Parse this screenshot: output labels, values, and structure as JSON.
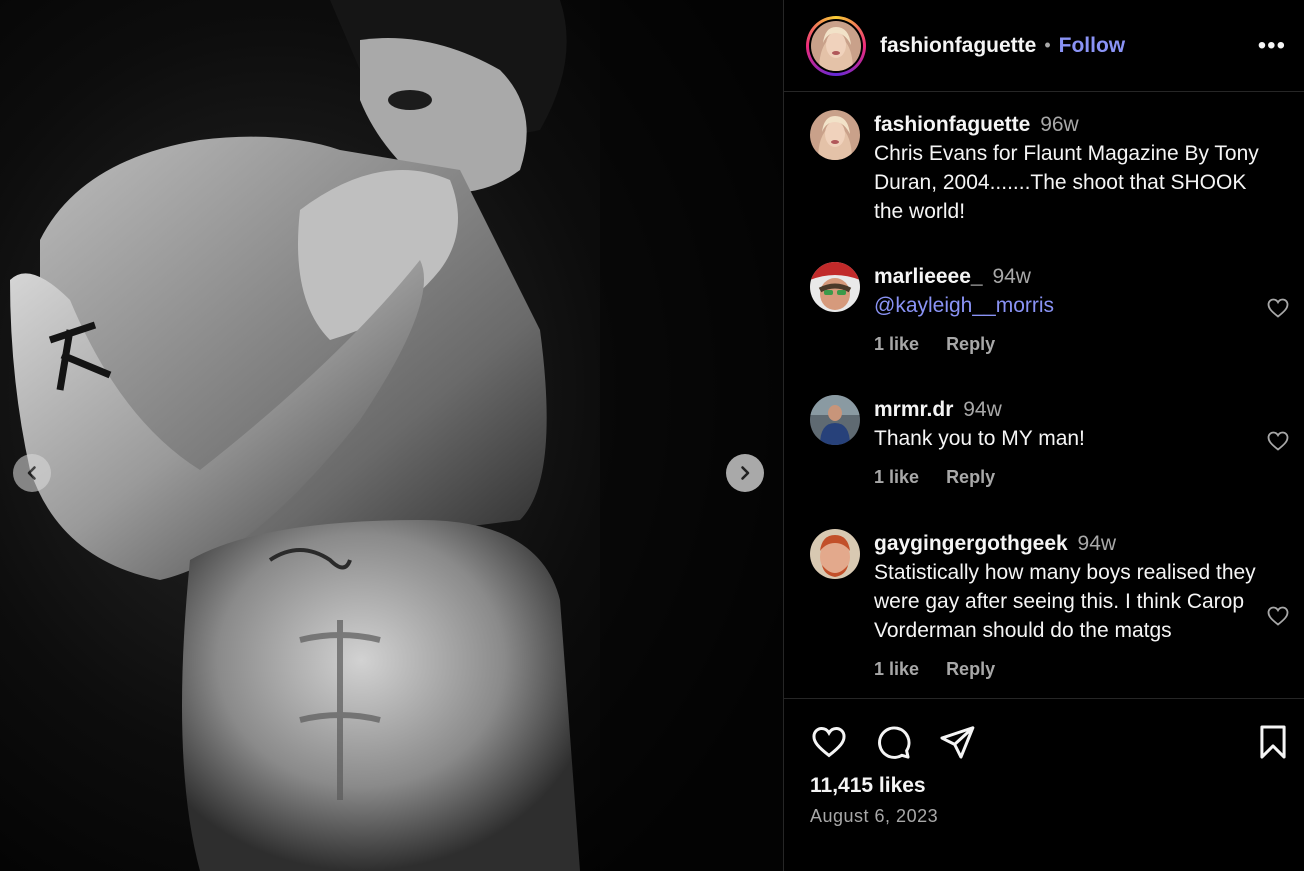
{
  "post": {
    "username": "fashionfaguette",
    "follow_label": "Follow",
    "separator": "•",
    "more_label": "•••",
    "likes": "11,415 likes",
    "date": "August 6, 2023"
  },
  "media": {
    "image_alt": "Black and white photo of a man lifting his t-shirt to his face"
  },
  "caption": {
    "username": "fashionfaguette",
    "time": "96w",
    "text": "Chris Evans for Flaunt Magazine By Tony Duran, 2004.......The shoot that SHOOK the world!"
  },
  "comments": [
    {
      "username": "marlieeee_",
      "time": "94w",
      "mention": "@kayleigh__morris",
      "text": "",
      "likes": "1 like",
      "reply": "Reply"
    },
    {
      "username": "mrmr.dr",
      "time": "94w",
      "mention": "",
      "text": "Thank you to MY man!",
      "likes": "1 like",
      "reply": "Reply"
    },
    {
      "username": "gaygingergothgeek",
      "time": "94w",
      "mention": "",
      "text": "Statistically how many boys realised they were gay after seeing this. I think Carop Vorderman should do the matgs",
      "likes": "1 like",
      "reply": "Reply"
    }
  ],
  "icons": [
    "chevron-left-icon",
    "chevron-right-icon",
    "more-icon",
    "heart-icon",
    "comment-icon",
    "share-icon",
    "bookmark-icon"
  ],
  "colors": {
    "accent": "#8a93f5",
    "text": "#f5f5f5",
    "muted": "#a8a8a8",
    "divider": "#262626",
    "background": "#000000"
  }
}
